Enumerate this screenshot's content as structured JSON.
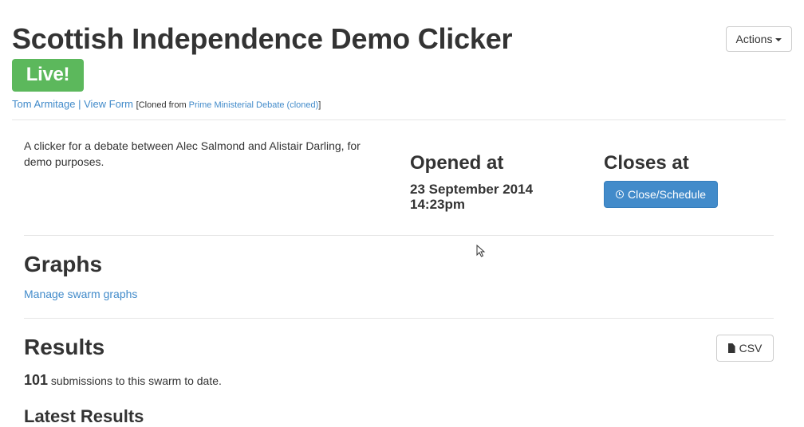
{
  "header": {
    "title": "Scottish Independence Demo Clicker",
    "status_badge": "Live!",
    "author_link": "Tom Armitage",
    "separator": "|",
    "view_form_link": "View Form",
    "cloned_prefix": "[Cloned from ",
    "cloned_source_link": "Prime Ministerial Debate (cloned)",
    "cloned_suffix": "]",
    "actions_button": "Actions"
  },
  "details": {
    "description": "A clicker for a debate between Alec Salmond and Alistair Darling, for demo purposes.",
    "opened_at_heading": "Opened at",
    "opened_at_value_line1": "23 September 2014",
    "opened_at_value_line2": "14:23pm",
    "closes_at_heading": "Closes at",
    "close_schedule_button": "Close/Schedule"
  },
  "graphs": {
    "heading": "Graphs",
    "manage_link": "Manage swarm graphs"
  },
  "results": {
    "heading": "Results",
    "csv_button": "CSV",
    "submission_count": "101",
    "submission_text": " submissions to this swarm to date.",
    "latest_heading": "Latest Results"
  },
  "colors": {
    "live_badge": "#5cb85c",
    "primary_button": "#428bca",
    "link": "#428bca",
    "text": "#333333"
  },
  "icons": {
    "actions_caret": "caret-down-icon",
    "close_button_icon": "clock-icon",
    "csv_button_icon": "file-icon",
    "cursor": "mouse-pointer-icon"
  }
}
